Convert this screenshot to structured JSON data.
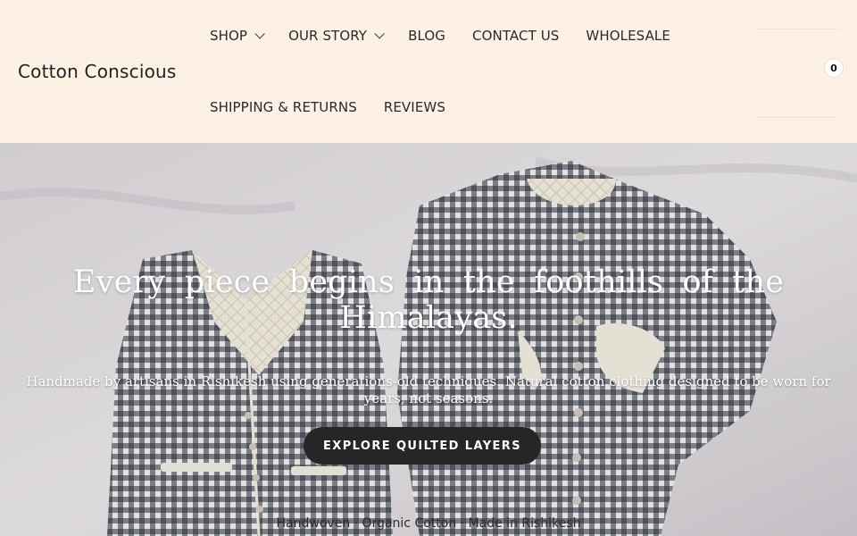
{
  "brand": {
    "name": "Cotton Conscious"
  },
  "nav": {
    "row1": [
      {
        "label": "SHOP",
        "has_dropdown": true
      },
      {
        "label": "OUR STORY",
        "has_dropdown": true
      },
      {
        "label": "BLOG",
        "has_dropdown": false
      },
      {
        "label": "CONTACT US",
        "has_dropdown": false
      },
      {
        "label": "WHOLESALE",
        "has_dropdown": false
      }
    ],
    "row2": [
      {
        "label": "SHIPPING & RETURNS",
        "has_dropdown": false
      },
      {
        "label": "REVIEWS",
        "has_dropdown": false
      }
    ]
  },
  "cart": {
    "count": "0"
  },
  "hero": {
    "title": "Every piece begins in the foothills of the Himalayas.",
    "subtitle": "Handmade by artisans in Rishikesh using generations-old techniques. Natural cotton clothing designed to be worn for years, not seasons.",
    "cta_label": "EXPLORE QUILTED LAYERS",
    "tagline": "Handwoven · Organic Cotton · Made in Rishikesh"
  },
  "colors": {
    "header_bg": "#fcf1e4",
    "cta_bg": "#262626",
    "text": "#222222",
    "gingham_dark": "#2b2f3a",
    "quilt_cream": "#f2ece0"
  },
  "icons": {
    "dropdown": "chevron-down-icon",
    "cart": "cart-icon"
  }
}
